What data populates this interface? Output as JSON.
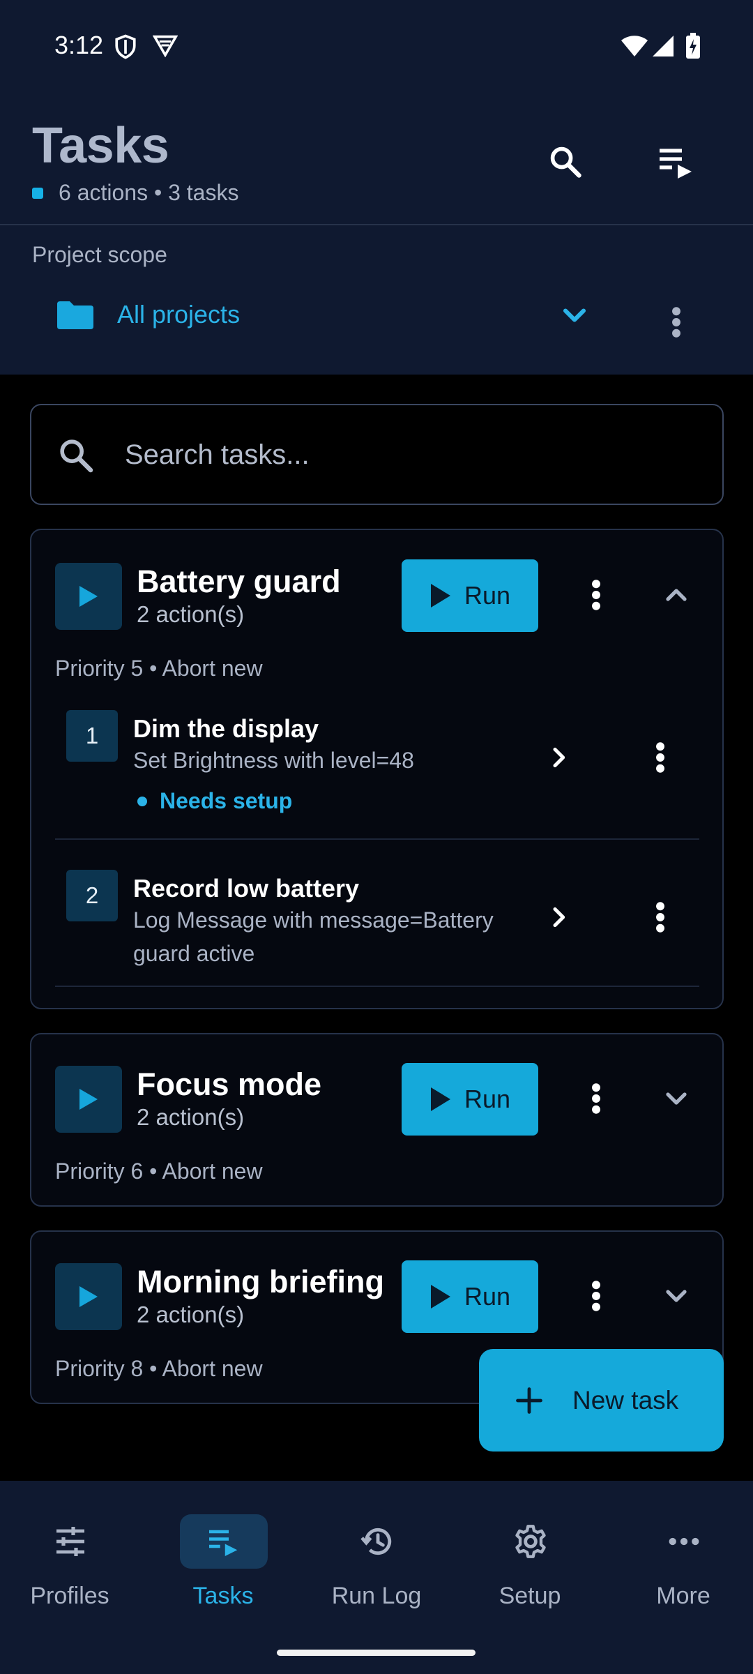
{
  "status_bar": {
    "time": "3:12"
  },
  "header": {
    "title": "Tasks",
    "subtitle": "6 actions • 3 tasks",
    "accent": "#16b1e6"
  },
  "scope": {
    "label": "Project scope",
    "value": "All projects"
  },
  "search": {
    "placeholder": "Search tasks..."
  },
  "tasks": [
    {
      "name": "Battery guard",
      "count": "2 action(s)",
      "run_label": "Run",
      "meta": "Priority 5 • Abort new",
      "expanded": true,
      "actions": [
        {
          "num": "1",
          "title": "Dim the display",
          "desc": "Set Brightness with level=48",
          "warning": "Needs setup"
        },
        {
          "num": "2",
          "title": "Record low battery",
          "desc": "Log Message with message=Battery guard active"
        }
      ]
    },
    {
      "name": "Focus mode",
      "count": "2 action(s)",
      "run_label": "Run",
      "meta": "Priority 6 • Abort new",
      "expanded": false
    },
    {
      "name": "Morning briefing",
      "count": "2 action(s)",
      "run_label": "Run",
      "meta": "Priority 8 • Abort new",
      "expanded": false
    }
  ],
  "fab": {
    "label": "New task"
  },
  "nav": [
    {
      "label": "Profiles",
      "icon": "tune-icon",
      "active": false
    },
    {
      "label": "Tasks",
      "icon": "task-list-icon",
      "active": true
    },
    {
      "label": "Run Log",
      "icon": "history-icon",
      "active": false
    },
    {
      "label": "Setup",
      "icon": "gear-icon",
      "active": false
    },
    {
      "label": "More",
      "icon": "more-horizontal-icon",
      "active": false
    }
  ]
}
